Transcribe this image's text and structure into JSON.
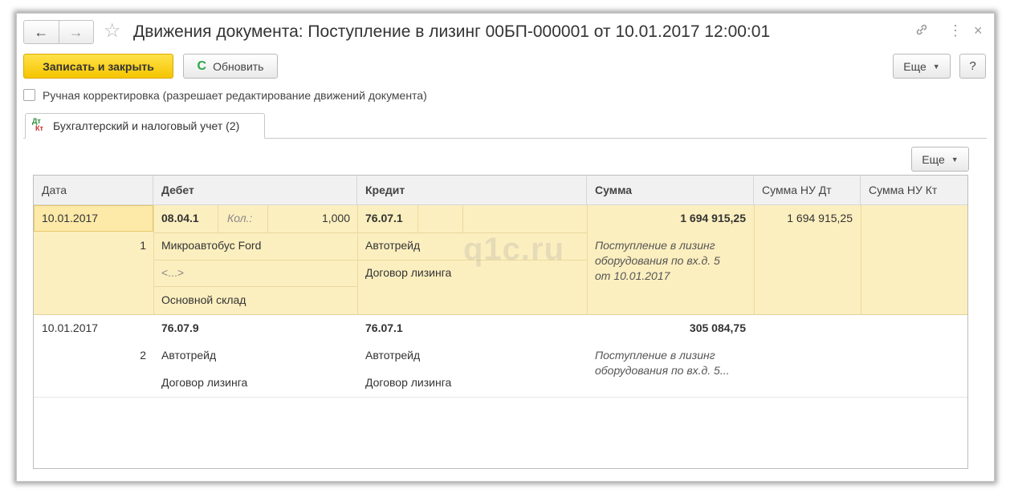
{
  "window": {
    "title": "Движения документа: Поступление в лизинг 00БП-000001 от 10.01.2017 12:00:01",
    "nav_back": "←",
    "nav_forward": "→",
    "star": "☆",
    "link_icon": "🔗",
    "more_icon": "⋮",
    "close_icon": "×"
  },
  "toolbar": {
    "save_close_label": "Записать и закрыть",
    "refresh_icon": "C",
    "refresh_label": "Обновить",
    "more_label": "Еще",
    "help_label": "?"
  },
  "manual_correction": {
    "label": "Ручная корректировка (разрешает редактирование движений документа)",
    "checked": false
  },
  "tab": {
    "icon_top": "Дт",
    "icon_bottom": "Кт",
    "label": "Бухгалтерский и налоговый учет (2)"
  },
  "table": {
    "more_label": "Еще",
    "columns": [
      "Дата",
      "Дебет",
      "Кредит",
      "Сумма",
      "Сумма НУ Дт",
      "Сумма НУ Кт"
    ],
    "rows": [
      {
        "date": "10.01.2017",
        "number": "1",
        "debit_account": "08.04.1",
        "debit_qty_label": "Кол.:",
        "debit_qty": "1,000",
        "debit_sub1": "Микроавтобус Ford",
        "debit_sub2": "<...>",
        "debit_sub3": "Основной склад",
        "credit_account": "76.07.1",
        "credit_sub1": "Автотрейд",
        "credit_sub2": "Договор лизинга",
        "amount": "1 694 915,25",
        "desc_line1": "Поступление в лизинг",
        "desc_line2": "оборудования по вх.д. 5",
        "desc_line3": "от 10.01.2017",
        "nu_dt": "1 694 915,25",
        "nu_kt": ""
      },
      {
        "date": "10.01.2017",
        "number": "2",
        "debit_account": "76.07.9",
        "debit_sub1": "Автотрейд",
        "debit_sub2": "Договор лизинга",
        "credit_account": "76.07.1",
        "credit_sub1": "Автотрейд",
        "credit_sub2": "Договор лизинга",
        "amount": "305 084,75",
        "desc_line1": "Поступление в лизинг",
        "desc_line2": "оборудования по вх.д. 5...",
        "nu_dt": "",
        "nu_kt": ""
      }
    ]
  },
  "watermark": "q1c.ru",
  "colors": {
    "primary_button": "#f5c500",
    "selected_row": "#fcefbf",
    "refresh_icon": "#2aa84a"
  }
}
